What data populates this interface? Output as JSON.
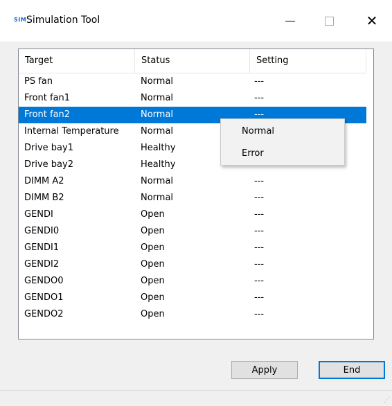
{
  "window": {
    "icon_text": "SIM",
    "title": "Simulation Tool"
  },
  "table": {
    "columns": [
      "Target",
      "Status",
      "Setting"
    ],
    "rows": [
      {
        "target": "PS fan",
        "status": "Normal",
        "setting": "---"
      },
      {
        "target": "Front fan1",
        "status": "Normal",
        "setting": "---"
      },
      {
        "target": "Front fan2",
        "status": "Normal",
        "setting": "---",
        "selected": true
      },
      {
        "target": "Internal Temperature",
        "status": "Normal",
        "setting": ""
      },
      {
        "target": "Drive bay1",
        "status": "Healthy",
        "setting": ""
      },
      {
        "target": "Drive bay2",
        "status": "Healthy",
        "setting": ""
      },
      {
        "target": "DIMM A2",
        "status": "Normal",
        "setting": "---"
      },
      {
        "target": "DIMM B2",
        "status": "Normal",
        "setting": "---"
      },
      {
        "target": "GENDI",
        "status": "Open",
        "setting": "---"
      },
      {
        "target": "GENDI0",
        "status": "Open",
        "setting": "---"
      },
      {
        "target": "GENDI1",
        "status": "Open",
        "setting": "---"
      },
      {
        "target": "GENDI2",
        "status": "Open",
        "setting": "---"
      },
      {
        "target": "GENDO0",
        "status": "Open",
        "setting": "---"
      },
      {
        "target": "GENDO1",
        "status": "Open",
        "setting": "---"
      },
      {
        "target": "GENDO2",
        "status": "Open",
        "setting": "---"
      }
    ]
  },
  "context_menu": {
    "items": [
      "Normal",
      "Error"
    ]
  },
  "buttons": {
    "apply": "Apply",
    "end": "End"
  },
  "colors": {
    "selection": "#0078d7",
    "default_button_border": "#0078d7"
  }
}
